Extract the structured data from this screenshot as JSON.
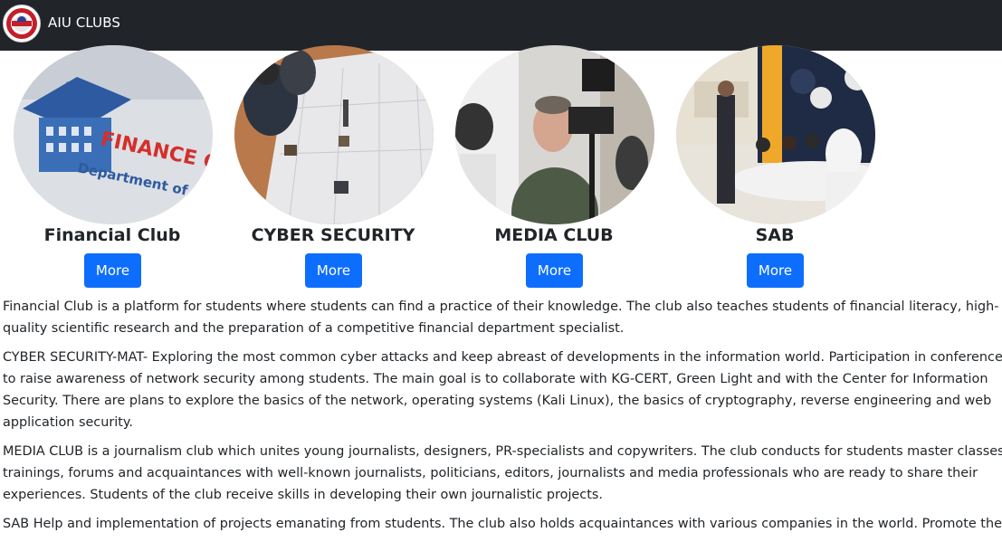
{
  "navbar": {
    "brand": "AIU CLUBS",
    "logo": "ala-too-university-seal"
  },
  "clubs": [
    {
      "name": "Financial Club",
      "button": "More",
      "image": "finance-club-sign-photo"
    },
    {
      "name": "CYBER SECURITY",
      "button": "More",
      "image": "robotics-workshop-photo"
    },
    {
      "name": "MEDIA CLUB",
      "button": "More",
      "image": "camera-interview-photo"
    },
    {
      "name": "SAB",
      "button": "More",
      "image": "student-meeting-photo"
    }
  ],
  "descriptions": [
    "Financial Club is a platform for students where students can find a practice of their knowledge. The club also teaches students of financial literacy, high-quality scientific research and the preparation of a competitive financial department specialist.",
    "CYBER SECURITY-MAT- Exploring the most common cyber attacks and keep abreast of developments in the information world. Participation in conferences to raise awareness of network security among students. The main goal is to collaborate with KG-CERT, Green Light and with the Center for Information Security. There are plans to explore the basics of the network, operating systems (Kali Linux), the basics of cryptography, reverse engineering and web application security.",
    "MEDIA CLUB is a journalism club which unites young journalists, designers, PR-specialists and copywriters. The club conducts for students master classes, trainings, forums and acquaintances with well-known journalists, politicians, editors, journalists and media professionals who are ready to share their experiences. Students of the club receive skills in developing their own journalistic projects.",
    "SAB Help and implementation of projects emanating from students. The club also holds acquaintances with various companies in the world. Promote the"
  ],
  "colors": {
    "navbar": "#212529",
    "button": "#0d6efd",
    "text": "#212529"
  }
}
